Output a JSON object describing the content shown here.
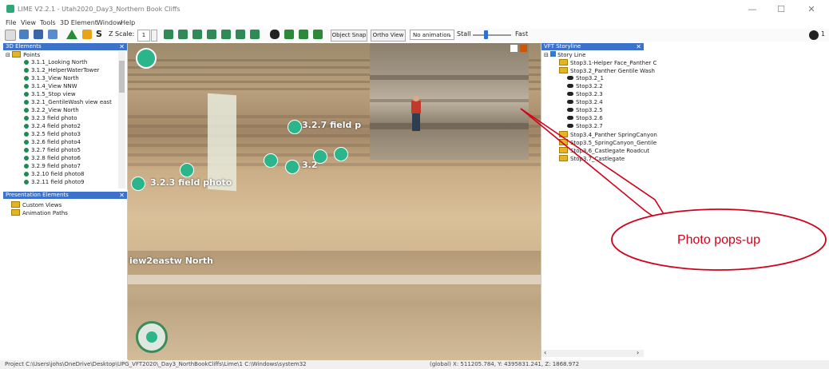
{
  "app": {
    "title": "LIME V2.2.1 - Utah2020_Day3_Northern Book Cliffs",
    "minimize": "—",
    "maximize": "☐",
    "close": "✕"
  },
  "menu": [
    "File",
    "View",
    "Tools",
    "3D Element",
    "Window",
    "Help"
  ],
  "toolbar": {
    "zscale_label": "Z Scale:",
    "zscale_value": "1",
    "object_snap": "Object Snap",
    "ortho_view": "Ortho View",
    "animation_select": "No animation",
    "stall_label": "Stall",
    "fast_label": "Fast",
    "user_count": "1"
  },
  "elements_panel": {
    "title": "3D Elements",
    "root": "Points",
    "items": [
      "3.1.1_Looking North",
      "3.1.2_HelperWaterTower",
      "3.1.3_View North",
      "3.1.4_View NNW",
      "3.1.5_Stop view",
      "3.2.1_GentileWash view east",
      "3.2.2_View North",
      "3.2.3 field photo",
      "3.2.4 field photo2",
      "3.2.5 field photo3",
      "3.2.6 field photo4",
      "3.2.7 field photo5",
      "3.2.8 field photo6",
      "3.2.9 field photo7",
      "3.2.10 field photo8",
      "3.2.11 field photo9"
    ]
  },
  "presentation_panel": {
    "title": "Presentation Elements",
    "items": [
      "Custom Views",
      "Animation Paths"
    ]
  },
  "viewport": {
    "labels": [
      "3.2.7 field p",
      "3.2.3 field photo",
      "3.2",
      "iew2eastw North"
    ]
  },
  "storyline_panel": {
    "title": "VFT Storyline",
    "root": "Story Line",
    "items": [
      {
        "label": "Stop3.1-Helper Face_Panther C",
        "kind": "folder"
      },
      {
        "label": "Stop3.2_Panther Gentile Wash",
        "kind": "folder"
      },
      {
        "label": "Stop3.2_1",
        "kind": "bino"
      },
      {
        "label": "Stop3.2.2",
        "kind": "bino"
      },
      {
        "label": "Stop3.2.3",
        "kind": "bino"
      },
      {
        "label": "Stop3.2.4",
        "kind": "bino"
      },
      {
        "label": "Stop3.2.5",
        "kind": "bino"
      },
      {
        "label": "Stop3.2.6",
        "kind": "bino"
      },
      {
        "label": "Stop3.2.7",
        "kind": "bino"
      },
      {
        "label": "Stop3.4_Panther SpringCanyon",
        "kind": "folder"
      },
      {
        "label": "Stop3.5_SpringCanyon_Gentile",
        "kind": "folder"
      },
      {
        "label": "Stop3.6_Castlegate Roadcut",
        "kind": "folder"
      },
      {
        "label": "Stop3.7_Castlegate",
        "kind": "folder"
      }
    ]
  },
  "callout": {
    "text": "Photo pops-up",
    "color": "#d0021b"
  },
  "status": {
    "left": "Project C:\\Users\\johs\\OneDrive\\Desktop\\UPG_VFT2020\\_Day3_NorthBookCliffs\\Lime\\1 C:\\Windows\\system32",
    "right": "(global) X: 511205.784, Y: 4395831.241, Z: 1868.972"
  }
}
